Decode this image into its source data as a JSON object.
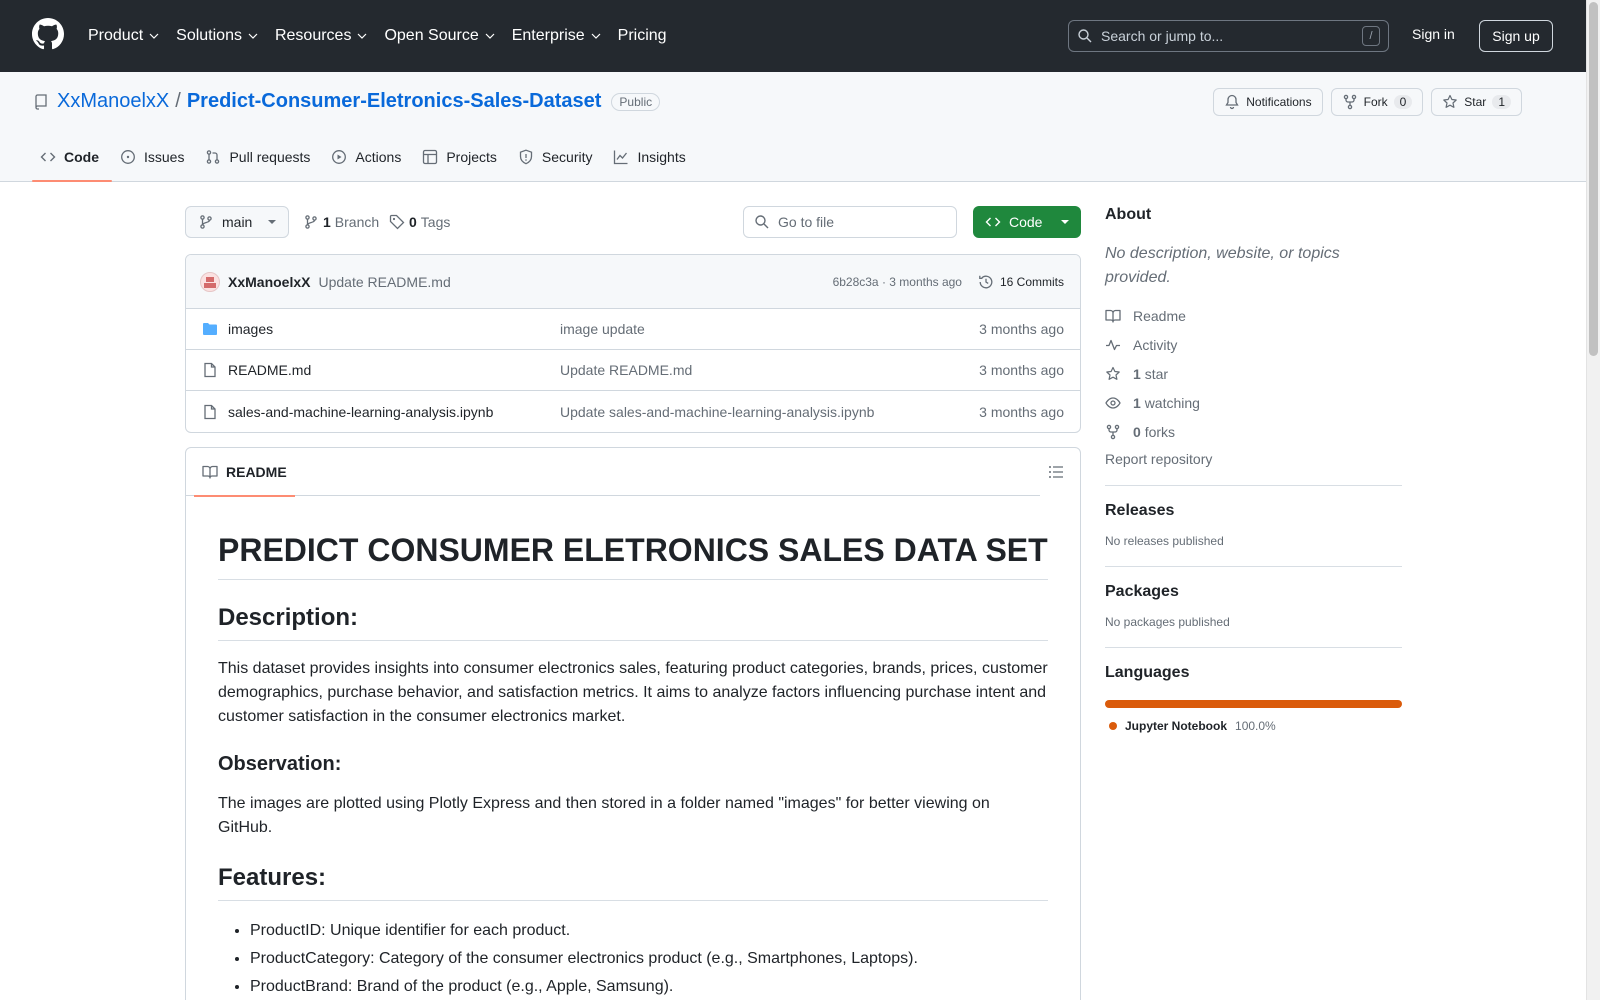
{
  "header": {
    "nav": [
      "Product",
      "Solutions",
      "Resources",
      "Open Source",
      "Enterprise",
      "Pricing"
    ],
    "search_placeholder": "Search or jump to...",
    "search_shortcut": "/",
    "sign_in": "Sign in",
    "sign_up": "Sign up"
  },
  "repo": {
    "owner": "XxManoelxX",
    "separator": "/",
    "name": "Predict-Consumer-Eletronics-Sales-Dataset",
    "visibility": "Public",
    "notifications_label": "Notifications",
    "fork_label": "Fork",
    "fork_count": "0",
    "star_label": "Star",
    "star_count": "1",
    "tabs": [
      "Code",
      "Issues",
      "Pull requests",
      "Actions",
      "Projects",
      "Security",
      "Insights"
    ]
  },
  "toolbar": {
    "branch": "main",
    "branch_count": "1",
    "branch_label": "Branch",
    "tag_count": "0",
    "tag_label": "Tags",
    "goto_placeholder": "Go to file",
    "code_label": "Code"
  },
  "latest_commit": {
    "author": "XxManoelxX",
    "message": "Update README.md",
    "sha_time": "6b28c3a · 3 months ago",
    "commits": "16 Commits"
  },
  "files": [
    {
      "name": "images",
      "type": "folder",
      "message": "image update",
      "age": "3 months ago"
    },
    {
      "name": "README.md",
      "type": "file",
      "message": "Update README.md",
      "age": "3 months ago"
    },
    {
      "name": "sales-and-machine-learning-analysis.ipynb",
      "type": "file",
      "message": "Update sales-and-machine-learning-analysis.ipynb",
      "age": "3 months ago"
    }
  ],
  "readme": {
    "tab_label": "README",
    "title": "PREDICT CONSUMER ELETRONICS SALES DATA SET",
    "description_heading": "Description:",
    "description": "This dataset provides insights into consumer electronics sales, featuring product categories, brands, prices, customer demographics, purchase behavior, and satisfaction metrics. It aims to analyze factors influencing purchase intent and customer satisfaction in the consumer electronics market.",
    "observation_heading": "Observation:",
    "observation": "The images are plotted using Plotly Express and then stored in a folder named \"images\" for better viewing on GitHub.",
    "features_heading": "Features:",
    "features": [
      "ProductID: Unique identifier for each product.",
      "ProductCategory: Category of the consumer electronics product (e.g., Smartphones, Laptops).",
      "ProductBrand: Brand of the product (e.g., Apple, Samsung)."
    ]
  },
  "sidebar": {
    "about_heading": "About",
    "about_desc": "No description, website, or topics provided.",
    "readme_link": "Readme",
    "activity_link": "Activity",
    "stars_count": "1",
    "stars_label": "star",
    "watching_count": "1",
    "watching_label": "watching",
    "forks_count": "0",
    "forks_label": "forks",
    "report": "Report repository",
    "releases_heading": "Releases",
    "releases_text": "No releases published",
    "packages_heading": "Packages",
    "packages_text": "No packages published",
    "languages_heading": "Languages",
    "language_name": "Jupyter Notebook",
    "language_pct": "100.0%",
    "language_color": "#da5b0b"
  },
  "colors": {
    "header_bg": "#24292f",
    "link": "#0969da",
    "primary_button": "#1f883d",
    "tab_underline": "#fd8c73"
  }
}
